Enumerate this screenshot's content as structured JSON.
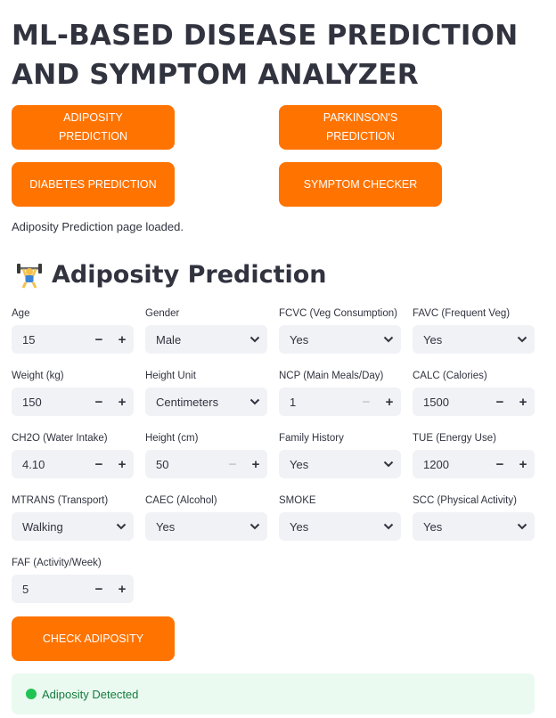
{
  "header": {
    "title_line1": "ML-BASED DISEASE PREDICTION",
    "title_line2": "AND SYMPTOM ANALYZER"
  },
  "nav": {
    "adiposity": "ADIPOSITY PREDICTION",
    "parkinsons_line1": "PARKINSON'S",
    "parkinsons_line2": "PREDICTION",
    "diabetes": "DIABETES PREDICTION",
    "symptom": "SYMPTOM CHECKER"
  },
  "status": "Adiposity Prediction page loaded.",
  "section": {
    "title": "Adiposity Prediction",
    "icon": "weightlifter-icon"
  },
  "fields": {
    "age": {
      "label": "Age",
      "value": "15"
    },
    "gender": {
      "label": "Gender",
      "value": "Male"
    },
    "fcvc": {
      "label": "FCVC (Veg Consumption)",
      "value": "Yes"
    },
    "favc": {
      "label": "FAVC (Frequent Veg)",
      "value": "Yes"
    },
    "weight": {
      "label": "Weight (kg)",
      "value": "150"
    },
    "height_unit": {
      "label": "Height Unit",
      "value": "Centimeters"
    },
    "ncp": {
      "label": "NCP (Main Meals/Day)",
      "value": "1"
    },
    "calc": {
      "label": "CALC (Calories)",
      "value": "1500"
    },
    "ch2o": {
      "label": "CH2O (Water Intake)",
      "value": "4.10"
    },
    "height": {
      "label": "Height (cm)",
      "value": "50"
    },
    "family": {
      "label": "Family History",
      "value": "Yes"
    },
    "tue": {
      "label": "TUE (Energy Use)",
      "value": "1200"
    },
    "mtrans": {
      "label": "MTRANS (Transport)",
      "value": "Walking"
    },
    "caec": {
      "label": "CAEC (Alcohol)",
      "value": "Yes"
    },
    "smoke": {
      "label": "SMOKE",
      "value": "Yes"
    },
    "scc": {
      "label": "SCC (Physical Activity)",
      "value": "Yes"
    },
    "faf": {
      "label": "FAF (Activity/Week)",
      "value": "5"
    }
  },
  "stepper": {
    "minus": "−",
    "plus": "+"
  },
  "check_button": "CHECK ADIPOSITY",
  "result": "Adiposity Detected",
  "colors": {
    "accent": "#ff7300",
    "success": "#21c354",
    "input_bg": "#f0f2f6"
  }
}
